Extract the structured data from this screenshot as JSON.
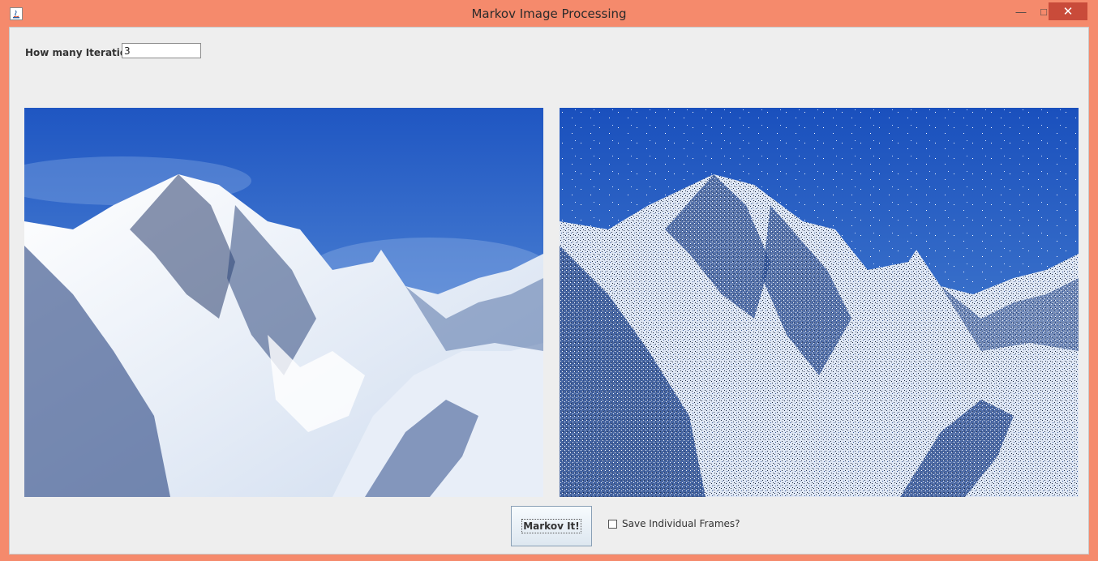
{
  "window": {
    "title": "Markov Image Processing",
    "minimize_glyph": "—",
    "maximize_glyph": "□",
    "close_glyph": "✕"
  },
  "controls": {
    "iterations_label": "How many Iterations:",
    "iterations_value": "3",
    "markov_button_label": "Markov It!",
    "save_frames_label": "Save Individual Frames?",
    "save_frames_checked": false
  },
  "images": {
    "original": "mountain-original-image",
    "processed": "mountain-processed-image"
  },
  "colors": {
    "titlebar": "#f58a6c",
    "close_button": "#c94b3a",
    "panel_bg": "#eeeeee",
    "sky": "#2f6fcb"
  }
}
